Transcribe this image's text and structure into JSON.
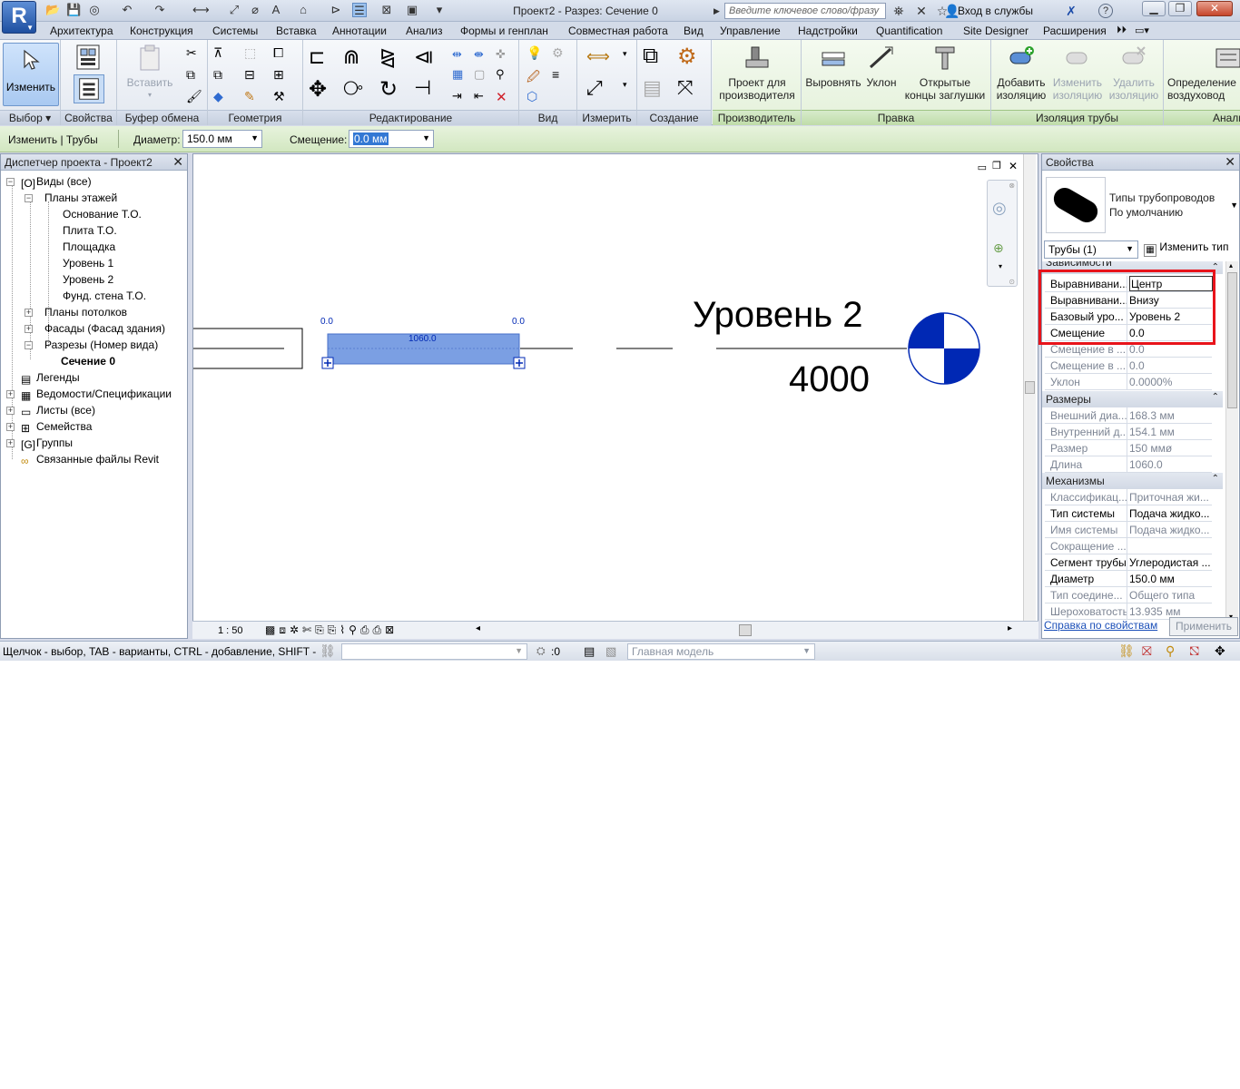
{
  "titlebar": {
    "app_letter": "R",
    "window_title": "Проект2 - Разрез: Сечение 0",
    "search_placeholder": "Введите ключевое слово/фразу",
    "sign_in": "Вход в службы",
    "quick_access_icons": [
      "open-icon",
      "save-icon",
      "sync-icon",
      "undo-icon",
      "redo-icon",
      "measure-icon",
      "dimension-icon",
      "tag-icon",
      "text-icon",
      "3d-icon",
      "section-icon",
      "thin-lines-icon",
      "close-views-icon",
      "switch-windows-icon"
    ]
  },
  "tabs": [
    "Архитектура",
    "Конструкция",
    "Системы",
    "Вставка",
    "Аннотации",
    "Анализ",
    "Формы и генплан",
    "Совместная работа",
    "Вид",
    "Управление",
    "Надстройки",
    "Quantification",
    "Site Designer",
    "Расширения"
  ],
  "ribbon": {
    "modify_label": "Изменить",
    "paste_label": "Вставить",
    "panels": {
      "select": "Выбор",
      "properties": "Свойства",
      "clipboard": "Буфер обмена",
      "geometry": "Геометрия",
      "edit": "Редактирование",
      "view": "Вид",
      "measure": "Измерить",
      "create": "Создание",
      "fabrication": "Производитель",
      "edit_pipe": "Правка",
      "insulation": "Изоляция трубы",
      "analysis": "Анали"
    },
    "fabrication_btn": [
      "Проект для",
      "производителя"
    ],
    "align_btn": "Выровнять",
    "slope_btn": "Уклон",
    "caps_btn": [
      "Открытые",
      "концы заглушки"
    ],
    "add_insul": [
      "Добавить",
      "изоляцию"
    ],
    "edit_insul": [
      "Изменить",
      "изоляцию"
    ],
    "del_insul": [
      "Удалить",
      "изоляцию"
    ],
    "airflow": [
      "Определение",
      "воздуховод"
    ]
  },
  "optionsbar": {
    "context": "Изменить | Трубы",
    "diameter_label": "Диаметр:",
    "diameter_value": "150.0 мм",
    "offset_label": "Смещение:",
    "offset_value": "0.0 мм"
  },
  "browser": {
    "title": "Диспетчер проекта - Проект2",
    "items": {
      "views": "Виды (все)",
      "floor_plans": "Планы этажей",
      "fp1": "Основание Т.О.",
      "fp2": "Плита Т.О.",
      "fp3": "Площадка",
      "fp4": "Уровень 1",
      "fp5": "Уровень 2",
      "fp6": "Фунд. стена Т.О.",
      "ceilings": "Планы потолков",
      "elevations": "Фасады (Фасад здания)",
      "sections": "Разрезы (Номер вида)",
      "section0": "Сечение 0",
      "legends": "Легенды",
      "schedules": "Ведомости/Спецификации",
      "sheets": "Листы (все)",
      "families": "Семейства",
      "groups": "Группы",
      "links": "Связанные файлы Revit"
    }
  },
  "canvas": {
    "level_name": "Уровень 2",
    "level_elev": "4000",
    "pipe_length": "1060.0",
    "end_left": "0.0",
    "end_right": "0.0",
    "scale": "1 : 50"
  },
  "properties": {
    "title": "Свойства",
    "type_family": "Типы трубопроводов",
    "type_name": "По умолчанию",
    "selector": "Трубы (1)",
    "edit_type": "Изменить тип",
    "group_constraints": "Зависимости",
    "group_dimensions": "Размеры",
    "group_mechanical": "Механизмы",
    "rows": [
      {
        "k": "Выравнивани...",
        "v": "Центр"
      },
      {
        "k": "Выравнивани...",
        "v": "Внизу"
      },
      {
        "k": "Базовый уро...",
        "v": "Уровень 2"
      },
      {
        "k": "Смещение",
        "v": "0.0"
      },
      {
        "k": "Смещение в ...",
        "v": "0.0"
      },
      {
        "k": "Смещение в ...",
        "v": "0.0"
      },
      {
        "k": "Уклон",
        "v": "0.0000%"
      }
    ],
    "dim_rows": [
      {
        "k": "Внешний диа...",
        "v": "168.3 мм"
      },
      {
        "k": "Внутренний д...",
        "v": "154.1 мм"
      },
      {
        "k": "Размер",
        "v": "150 ммø"
      },
      {
        "k": "Длина",
        "v": "1060.0"
      }
    ],
    "mech_rows": [
      {
        "k": "Классификац...",
        "v": "Приточная жи..."
      },
      {
        "k": "Тип системы",
        "v": "Подача жидко..."
      },
      {
        "k": "Имя системы",
        "v": "Подача жидко..."
      },
      {
        "k": "Сокращение ...",
        "v": ""
      },
      {
        "k": "Сегмент трубы",
        "v": "Углеродистая ..."
      },
      {
        "k": "Диаметр",
        "v": "150.0 мм"
      },
      {
        "k": "Тип соедине...",
        "v": "Общего типа"
      },
      {
        "k": "Шероховатость",
        "v": "13.935 мм"
      }
    ],
    "help_link": "Справка по свойствам",
    "apply": "Применить"
  },
  "statusbar": {
    "hint": "Щелчок - выбор, TAB - варианты, CTRL - добавление, SHIFT - с",
    "count": ":0",
    "model": "Главная модель"
  },
  "colors": {
    "highlight_box": "#e8141b",
    "pipe_fill": "#7b9fe3",
    "level_blue": "#0028b4"
  }
}
